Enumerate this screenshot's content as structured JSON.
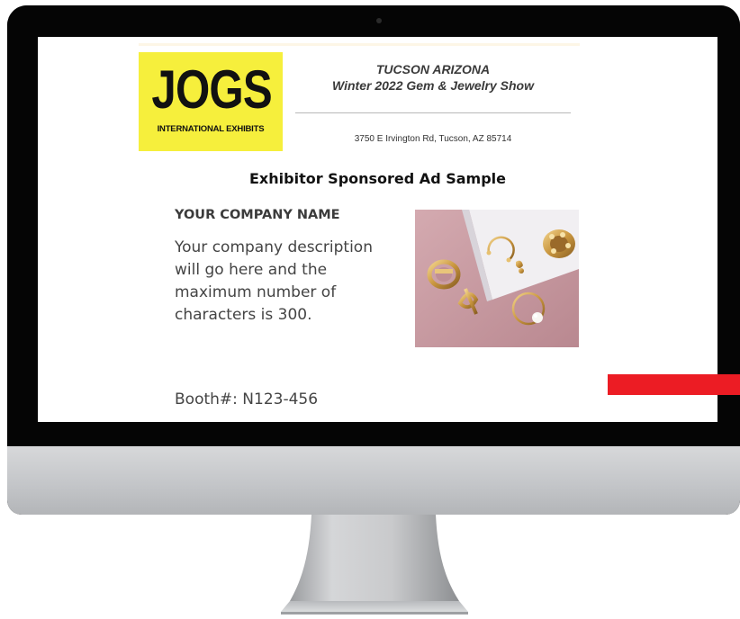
{
  "logo": {
    "text": "JOGS",
    "subtitle": "INTERNATIONAL EXHIBITS",
    "color": "#f6ef3c"
  },
  "show": {
    "city": "TUCSON ARIZONA",
    "name": "Winter 2022 Gem & Jewelry Show",
    "address": "3750 E Irvington Rd, Tucson, AZ 85714"
  },
  "ad": {
    "heading": "Exhibitor Sponsored Ad Sample",
    "company_name": "YOUR COMPANY NAME",
    "description": "Your company description will go here and the maximum number of characters is 300.",
    "booth": "Booth#: N123-456",
    "image": "jewelry-photo"
  },
  "colors": {
    "accent_red": "#ec1c24",
    "photo_background": "#c99ea4",
    "monitor_frame": "#050505"
  }
}
